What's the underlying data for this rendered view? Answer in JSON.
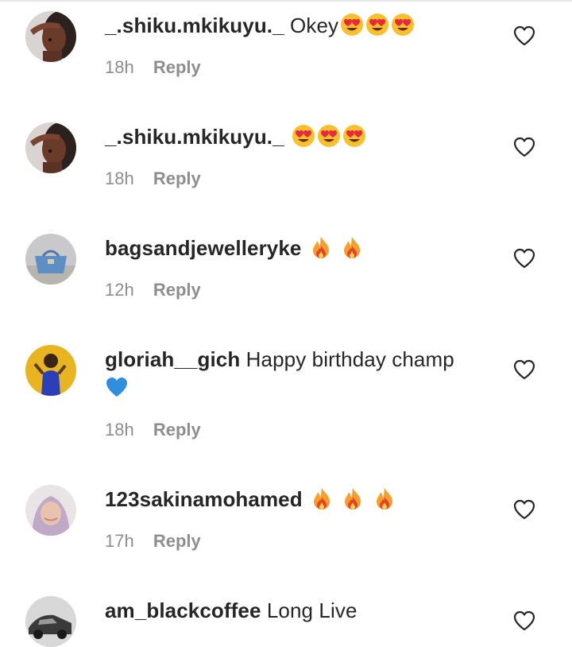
{
  "comments": [
    {
      "username": "_.shiku.mkikuyu._",
      "text": "Okey",
      "emoji": [
        "heart-eyes",
        "heart-eyes",
        "heart-eyes"
      ],
      "time": "18h",
      "reply": "Reply",
      "avatar": "woman-hand-on-forehead"
    },
    {
      "username": "_.shiku.mkikuyu._",
      "text": "",
      "emoji": [
        "heart-eyes",
        "heart-eyes",
        "heart-eyes"
      ],
      "time": "18h",
      "reply": "Reply",
      "avatar": "woman-hand-on-forehead"
    },
    {
      "username": "bagsandjewelleryke",
      "text": "",
      "emoji": [
        "fire",
        "fire"
      ],
      "time": "12h",
      "reply": "Reply",
      "avatar": "blue-handbag"
    },
    {
      "username": "gloriah__gich",
      "text": "Happy birthday champ",
      "emoji_second_line": [
        "blue-heart"
      ],
      "time": "18h",
      "reply": "Reply",
      "avatar": "woman-blue-dress-yellow-bg"
    },
    {
      "username": "123sakinamohamed",
      "text": "",
      "emoji": [
        "fire",
        "fire",
        "fire"
      ],
      "time": "17h",
      "reply": "Reply",
      "avatar": "woman-headscarf"
    },
    {
      "username": "am_blackcoffee",
      "text": "Long Live",
      "emoji": [],
      "time": "",
      "reply": "",
      "avatar": "monochrome-car"
    }
  ],
  "icons": {
    "like": "heart-outline-icon"
  },
  "colors": {
    "text": "#262626",
    "meta": "#8e8e8e",
    "background": "#ffffff"
  }
}
